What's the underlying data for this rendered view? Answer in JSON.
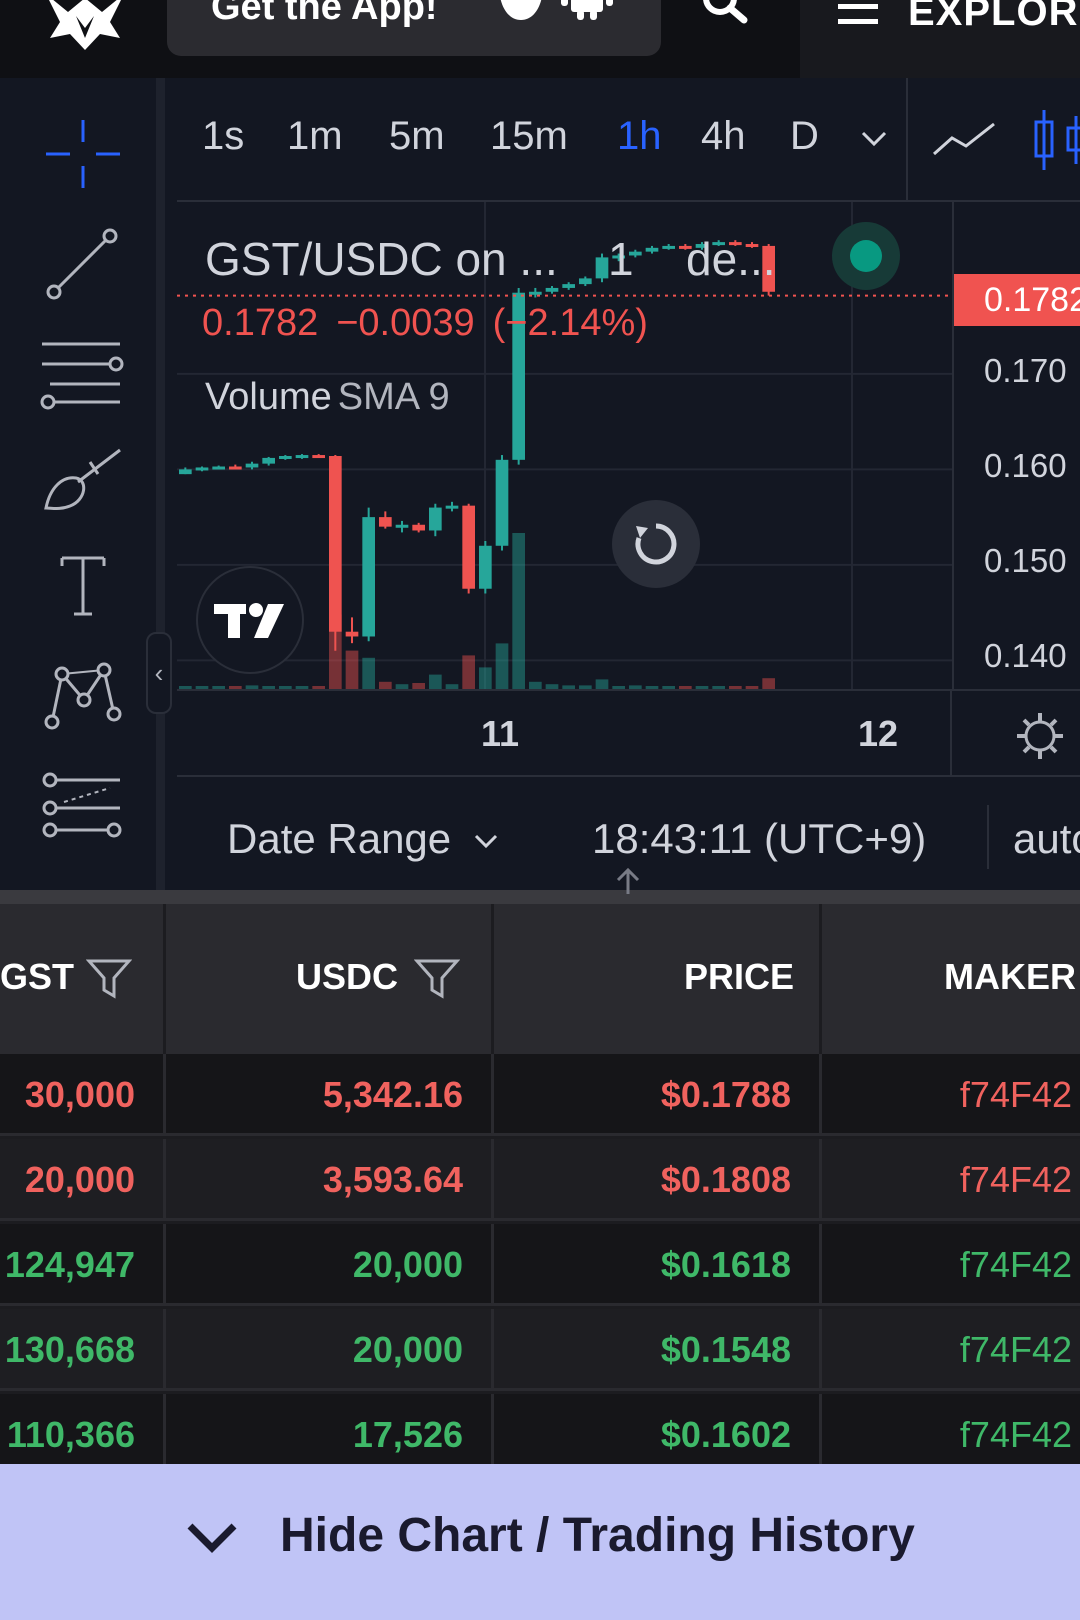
{
  "topbar": {
    "get_app_label": "Get the App!",
    "explore_label": "EXPLORE"
  },
  "timeframes": [
    "1s",
    "1m",
    "5m",
    "15m",
    "1h",
    "4h",
    "D"
  ],
  "active_timeframe": "1h",
  "legend": {
    "symbol": "GST/USDC on ...",
    "interval": "1",
    "exchange": "de...",
    "last": "0.1782",
    "change": "−0.0039",
    "change_pct": "(−2.14%)",
    "volume_label": "Volume",
    "sma_label": "SMA 9"
  },
  "price_scale": {
    "current_tag": "0.1782",
    "ticks": [
      "0.170",
      "0.160",
      "0.150",
      "0.140"
    ]
  },
  "time_axis": [
    "11",
    "12"
  ],
  "bottom_bar": {
    "date_range_label": "Date Range",
    "clock": "18:43:11 (UTC+9)",
    "auto_label": "auto"
  },
  "table": {
    "columns": [
      "GST",
      "USDC",
      "PRICE",
      "MAKER"
    ],
    "rows": [
      {
        "gst": "30,000",
        "usdc": "5,342.16",
        "price": "$0.1788",
        "maker": "f74F42",
        "side": "sell"
      },
      {
        "gst": "20,000",
        "usdc": "3,593.64",
        "price": "$0.1808",
        "maker": "f74F42",
        "side": "sell"
      },
      {
        "gst": "124,947",
        "usdc": "20,000",
        "price": "$0.1618",
        "maker": "f74F42",
        "side": "buy"
      },
      {
        "gst": "130,668",
        "usdc": "20,000",
        "price": "$0.1548",
        "maker": "f74F42",
        "side": "buy"
      },
      {
        "gst": "110,366",
        "usdc": "17,526",
        "price": "$0.1602",
        "maker": "f74F42",
        "side": "buy"
      }
    ]
  },
  "footer": {
    "label": "Hide Chart / Trading History"
  },
  "colors": {
    "up": "#26a69a",
    "down": "#ef5350",
    "accent": "#2962ff",
    "footer_bg": "#c0c4f6"
  },
  "chart_data": {
    "type": "candlestick",
    "x_ticks": [
      "11",
      "12"
    ],
    "ylim": [
      0.137,
      0.188
    ],
    "y_ticks": [
      0.17,
      0.16,
      0.15,
      0.14
    ],
    "last_price": 0.1782,
    "candles": [
      {
        "o": 0.1595,
        "h": 0.1602,
        "l": 0.1595,
        "c": 0.16,
        "v": 0.02
      },
      {
        "o": 0.16,
        "h": 0.1603,
        "l": 0.1598,
        "c": 0.1602,
        "v": 0.02
      },
      {
        "o": 0.1602,
        "h": 0.1604,
        "l": 0.16,
        "c": 0.1603,
        "v": 0.02
      },
      {
        "o": 0.1603,
        "h": 0.1605,
        "l": 0.16,
        "c": 0.1602,
        "v": 0.02
      },
      {
        "o": 0.1602,
        "h": 0.1608,
        "l": 0.16,
        "c": 0.1606,
        "v": 0.03
      },
      {
        "o": 0.1606,
        "h": 0.1613,
        "l": 0.1604,
        "c": 0.1612,
        "v": 0.02
      },
      {
        "o": 0.1612,
        "h": 0.1615,
        "l": 0.161,
        "c": 0.1614,
        "v": 0.02
      },
      {
        "o": 0.1614,
        "h": 0.1616,
        "l": 0.1611,
        "c": 0.1615,
        "v": 0.02
      },
      {
        "o": 0.1615,
        "h": 0.1616,
        "l": 0.1612,
        "c": 0.1614,
        "v": 0.02
      },
      {
        "o": 0.1614,
        "h": 0.1615,
        "l": 0.141,
        "c": 0.143,
        "v": 0.62
      },
      {
        "o": 0.143,
        "h": 0.1445,
        "l": 0.1418,
        "c": 0.1425,
        "v": 0.32
      },
      {
        "o": 0.1425,
        "h": 0.156,
        "l": 0.142,
        "c": 0.155,
        "v": 0.26
      },
      {
        "o": 0.155,
        "h": 0.1556,
        "l": 0.1538,
        "c": 0.154,
        "v": 0.06
      },
      {
        "o": 0.154,
        "h": 0.1546,
        "l": 0.1534,
        "c": 0.1542,
        "v": 0.04
      },
      {
        "o": 0.1542,
        "h": 0.1544,
        "l": 0.1534,
        "c": 0.1536,
        "v": 0.05
      },
      {
        "o": 0.1536,
        "h": 0.1564,
        "l": 0.153,
        "c": 0.156,
        "v": 0.12
      },
      {
        "o": 0.156,
        "h": 0.1566,
        "l": 0.1556,
        "c": 0.1562,
        "v": 0.04
      },
      {
        "o": 0.1562,
        "h": 0.1564,
        "l": 0.147,
        "c": 0.1475,
        "v": 0.28
      },
      {
        "o": 0.1475,
        "h": 0.1525,
        "l": 0.147,
        "c": 0.152,
        "v": 0.18
      },
      {
        "o": 0.152,
        "h": 0.1615,
        "l": 0.1515,
        "c": 0.161,
        "v": 0.38
      },
      {
        "o": 0.161,
        "h": 0.179,
        "l": 0.1605,
        "c": 0.1785,
        "v": 1.3
      },
      {
        "o": 0.1785,
        "h": 0.179,
        "l": 0.178,
        "c": 0.1786,
        "v": 0.06
      },
      {
        "o": 0.1786,
        "h": 0.1792,
        "l": 0.1784,
        "c": 0.179,
        "v": 0.04
      },
      {
        "o": 0.179,
        "h": 0.1796,
        "l": 0.1788,
        "c": 0.1794,
        "v": 0.03
      },
      {
        "o": 0.1794,
        "h": 0.1802,
        "l": 0.1792,
        "c": 0.18,
        "v": 0.03
      },
      {
        "o": 0.18,
        "h": 0.1826,
        "l": 0.1796,
        "c": 0.1822,
        "v": 0.08
      },
      {
        "o": 0.1822,
        "h": 0.1826,
        "l": 0.1818,
        "c": 0.1824,
        "v": 0.02
      },
      {
        "o": 0.1824,
        "h": 0.183,
        "l": 0.1822,
        "c": 0.1828,
        "v": 0.03
      },
      {
        "o": 0.1828,
        "h": 0.1834,
        "l": 0.1826,
        "c": 0.1832,
        "v": 0.02
      },
      {
        "o": 0.1832,
        "h": 0.1836,
        "l": 0.183,
        "c": 0.1834,
        "v": 0.02
      },
      {
        "o": 0.1834,
        "h": 0.1836,
        "l": 0.183,
        "c": 0.1832,
        "v": 0.02
      },
      {
        "o": 0.1832,
        "h": 0.1838,
        "l": 0.183,
        "c": 0.1836,
        "v": 0.02
      },
      {
        "o": 0.1836,
        "h": 0.184,
        "l": 0.1834,
        "c": 0.1838,
        "v": 0.02
      },
      {
        "o": 0.1838,
        "h": 0.184,
        "l": 0.1834,
        "c": 0.1836,
        "v": 0.02
      },
      {
        "o": 0.1836,
        "h": 0.1838,
        "l": 0.1832,
        "c": 0.1834,
        "v": 0.02
      },
      {
        "o": 0.1834,
        "h": 0.1836,
        "l": 0.1782,
        "c": 0.1786,
        "v": 0.09
      }
    ]
  }
}
